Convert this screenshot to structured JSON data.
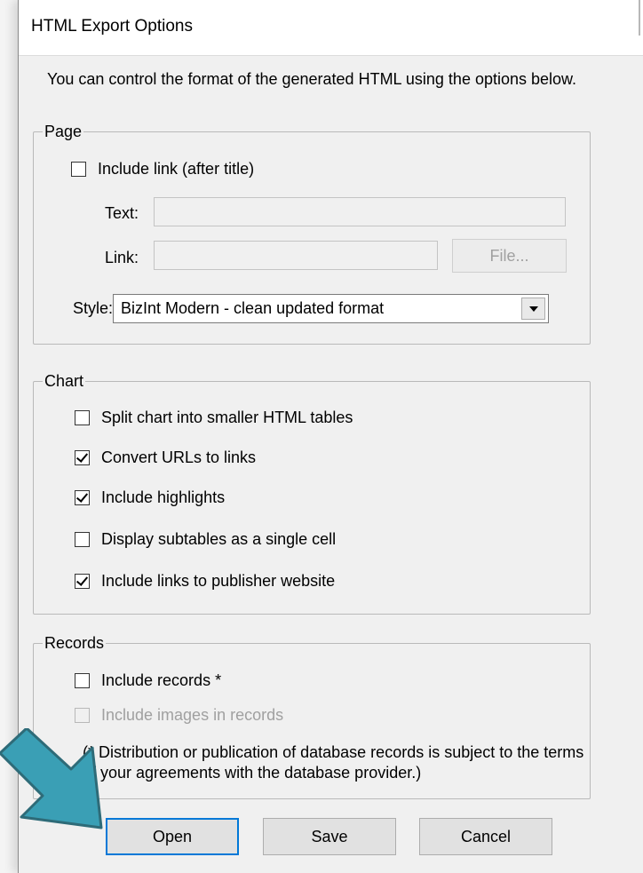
{
  "dialog": {
    "title": "HTML Export Options",
    "description": "You can control the format of the generated HTML using the options below."
  },
  "page_group": {
    "legend": "Page",
    "include_link": {
      "label": "Include link (after title)",
      "checked": false
    },
    "text_label": "Text:",
    "text_value": "",
    "link_label": "Link:",
    "link_value": "",
    "file_button": "File...",
    "style_label": "Style:",
    "style_value": "BizInt Modern - clean updated format"
  },
  "chart_group": {
    "legend": "Chart",
    "options": [
      {
        "label": "Split chart into smaller HTML tables",
        "checked": false
      },
      {
        "label": "Convert URLs to links",
        "checked": true
      },
      {
        "label": "Include highlights",
        "checked": true
      },
      {
        "label": "Display subtables as a single cell",
        "checked": false
      },
      {
        "label": "Include links to publisher website",
        "checked": true
      }
    ]
  },
  "records_group": {
    "legend": "Records",
    "include_records": {
      "label": "Include records *",
      "checked": false
    },
    "include_images": {
      "label": "Include images in records",
      "checked": false,
      "disabled": true
    },
    "note": "(* Distribution or publication of database records is subject to the terms of your agreements with the database provider.)"
  },
  "buttons": {
    "open": "Open",
    "save": "Save",
    "cancel": "Cancel"
  },
  "colors": {
    "arrow": "#3a9fb5",
    "arrow_outline": "#2e6b78",
    "focus": "#0078d7"
  },
  "icons": {
    "pointer": "arrow-pointer-icon",
    "dropdown": "chevron-down-icon",
    "check": "checkmark-icon"
  }
}
